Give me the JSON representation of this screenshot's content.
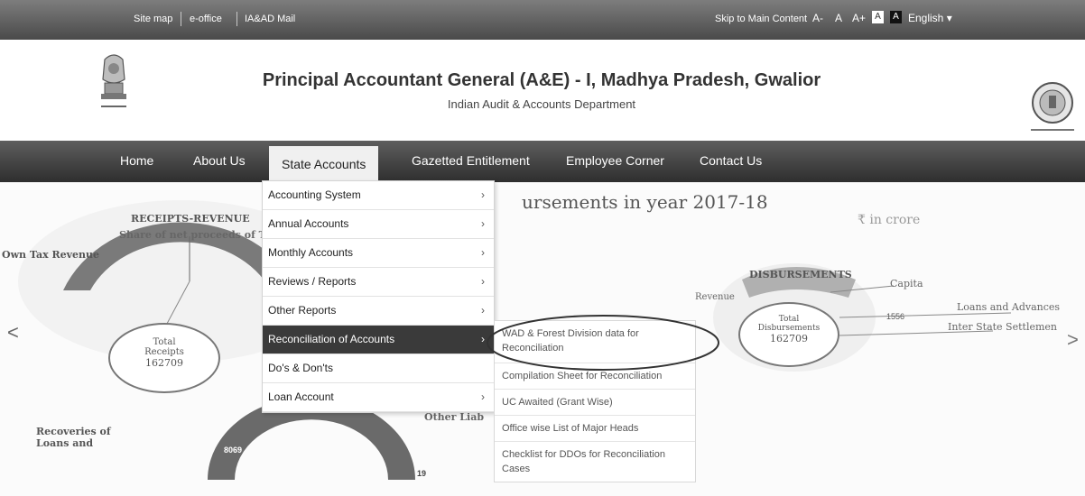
{
  "topbar": {
    "links": [
      "Site map",
      "e-office",
      "IA&AD Mail"
    ],
    "skip_link": "Skip to Main Content",
    "font_sizes": [
      "A-",
      "A",
      "A+"
    ],
    "contrast": [
      "A",
      "A"
    ],
    "language": "English"
  },
  "header": {
    "title": "Principal Accountant General (A&E) - I, Madhya Pradesh, Gwalior",
    "subtitle": "Indian Audit & Accounts Department"
  },
  "nav": {
    "items": [
      "Home",
      "About Us",
      "State Accounts",
      "Gazetted Entitlement",
      "Employee Corner",
      "Contact Us"
    ],
    "active": "State Accounts"
  },
  "dropdown": {
    "items": [
      {
        "label": "Accounting System"
      },
      {
        "label": "Annual Accounts"
      },
      {
        "label": "Monthly Accounts"
      },
      {
        "label": "Reviews / Reports"
      },
      {
        "label": "Other Reports"
      },
      {
        "label": "Reconciliation of Accounts"
      },
      {
        "label": "Do's & Don'ts"
      },
      {
        "label": "Loan Account"
      }
    ],
    "active_index": 5
  },
  "submenu": {
    "items": [
      "WAD & Forest Division data for Reconciliation",
      "Compilation Sheet for Reconciliation",
      "UC Awaited (Grant Wise)",
      "Office wise List of Major Heads",
      "Checklist for DDOs for Reconciliation Cases"
    ]
  },
  "banner": {
    "heading": "ursements in year 2017-18",
    "unit_note": "₹ in crore",
    "receipts_title": "RECEIPTS-REVENUE",
    "receipts_sub": "Share of net proceeds of T",
    "own_tax": "Own Tax Revenue",
    "total_receipts_label": "Total Receipts",
    "total_receipts_value": "162709",
    "recoveries": "Recoveries of Loans and",
    "other_lia": "Other Liab",
    "disbursements": "DISBURSEMENTS",
    "revenue": "Revenue",
    "capital": "Capita",
    "loans_advances": "Loans and Advances",
    "inter_state": "Inter State Settlemen",
    "total_disb_label": "Total Disbursements",
    "total_disb_value": "162709",
    "val_1556": "1556",
    "val_8069": "8069",
    "val_19": "19"
  },
  "carousel": {
    "prev": "<",
    "next": ">"
  }
}
